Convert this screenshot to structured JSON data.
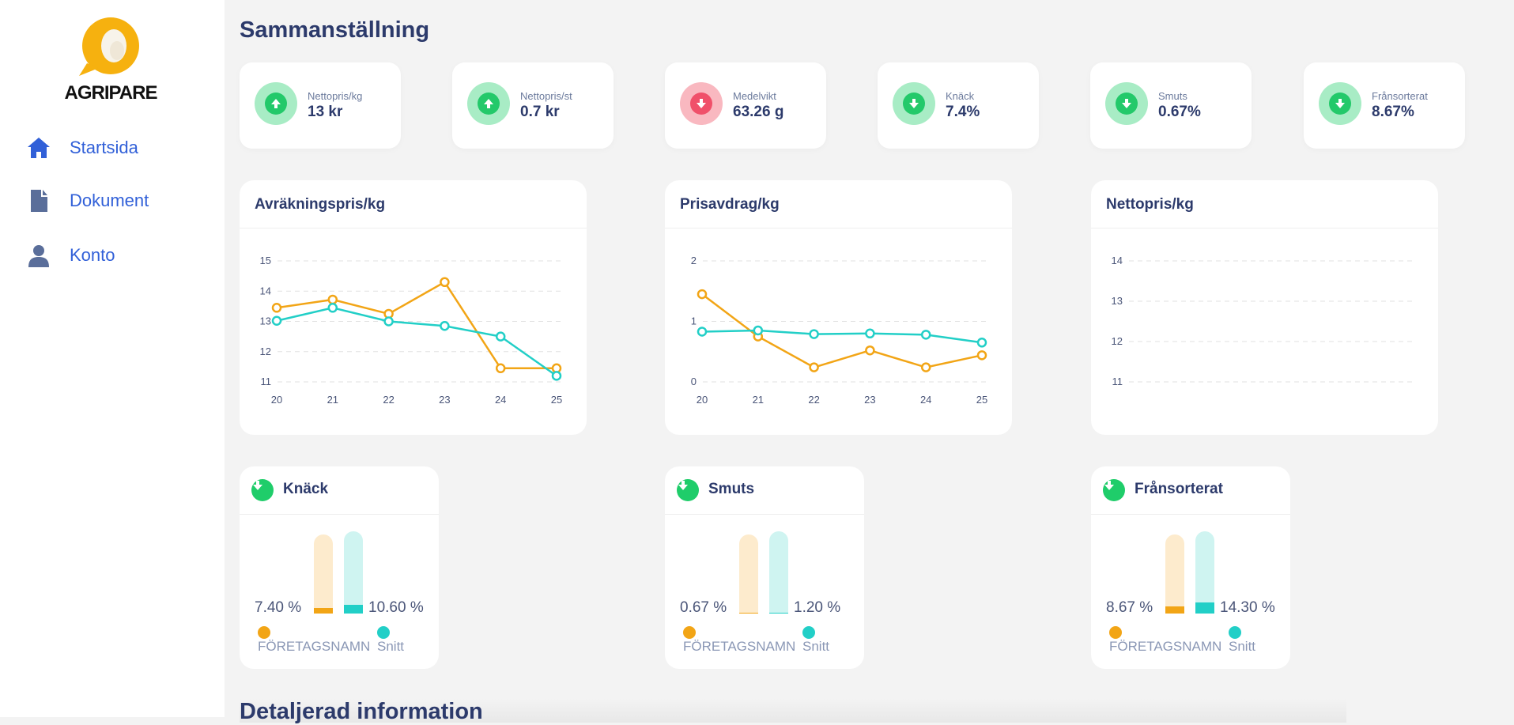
{
  "brand": {
    "name": "AGRIPARE"
  },
  "nav": [
    {
      "label": "Startsida",
      "icon": "home-icon"
    },
    {
      "label": "Dokument",
      "icon": "document-icon"
    },
    {
      "label": "Konto",
      "icon": "user-icon"
    }
  ],
  "page": {
    "title": "Sammanställning",
    "section2_title": "Detaljerad information"
  },
  "kpis": [
    {
      "label": "Nettopris/kg",
      "value": "13 kr",
      "trend": "up"
    },
    {
      "label": "Nettopris/st",
      "value": "0.7 kr",
      "trend": "up"
    },
    {
      "label": "Medelvikt",
      "value": "63.26 g",
      "trend": "bad"
    },
    {
      "label": "Knäck",
      "value": "7.4%",
      "trend": "down"
    },
    {
      "label": "Smuts",
      "value": "0.67%",
      "trend": "down"
    },
    {
      "label": "Frånsorterat",
      "value": "8.67%",
      "trend": "down"
    }
  ],
  "colors": {
    "series_company": "#f2a516",
    "series_avg": "#22cfc7",
    "good": "#1fcd6a",
    "bad": "#f0506a",
    "nav": "#3160d8"
  },
  "chart_data": [
    {
      "type": "line",
      "title": "Avräkningspris/kg",
      "x": [
        "20",
        "21",
        "22",
        "23",
        "24",
        "25"
      ],
      "yticks": [
        "11",
        "12",
        "13",
        "14",
        "15"
      ],
      "ylim": [
        11,
        15
      ],
      "grid": true,
      "series": [
        {
          "values": [
            13.45,
            13.72,
            13.25,
            14.3,
            11.45,
            11.45
          ]
        },
        {
          "values": [
            13.02,
            13.45,
            13.0,
            12.85,
            12.5,
            11.2
          ]
        }
      ]
    },
    {
      "type": "line",
      "title": "Prisavdrag/kg",
      "x": [
        "20",
        "21",
        "22",
        "23",
        "24",
        "25"
      ],
      "yticks": [
        "0",
        "1",
        "2"
      ],
      "ylim": [
        0,
        2
      ],
      "grid": true,
      "series": [
        {
          "values": [
            1.45,
            0.75,
            0.24,
            0.52,
            0.24,
            0.44
          ]
        },
        {
          "values": [
            0.83,
            0.85,
            0.79,
            0.8,
            0.78,
            0.65
          ]
        }
      ]
    },
    {
      "type": "line",
      "title": "Nettopris/kg",
      "x": [],
      "yticks": [
        "11",
        "12",
        "13",
        "14"
      ],
      "ylim": [
        11,
        14
      ],
      "grid": true,
      "series": []
    }
  ],
  "bar_cards": [
    {
      "title": "Knäck",
      "company_pct": "7.40 %",
      "avg_pct": "10.60 %",
      "company_value": 7.4,
      "avg_value": 10.6
    },
    {
      "title": "Smuts",
      "company_pct": "0.67 %",
      "avg_pct": "1.20 %",
      "company_value": 0.67,
      "avg_value": 1.2
    },
    {
      "title": "Frånsorterat",
      "company_pct": "8.67 %",
      "avg_pct": "14.30 %",
      "company_value": 8.67,
      "avg_value": 14.3
    }
  ],
  "legend": {
    "company": "FÖRETAGSNAMN",
    "avg": "Snitt"
  }
}
